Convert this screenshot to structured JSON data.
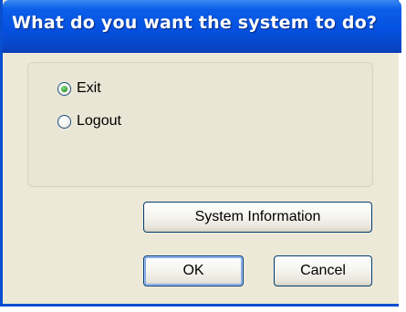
{
  "window": {
    "title": "What do you want the system to do?"
  },
  "options": [
    {
      "label": "Exit",
      "selected": true
    },
    {
      "label": "Logout",
      "selected": false
    }
  ],
  "buttons": {
    "system_info_label": "System Information",
    "ok_label": "OK",
    "cancel_label": "Cancel"
  },
  "colors": {
    "titlebar": "#0551e0",
    "frame": "#0a4ed1",
    "dialog_bg": "#ece9d8",
    "radio_selected": "#2fa32f"
  }
}
